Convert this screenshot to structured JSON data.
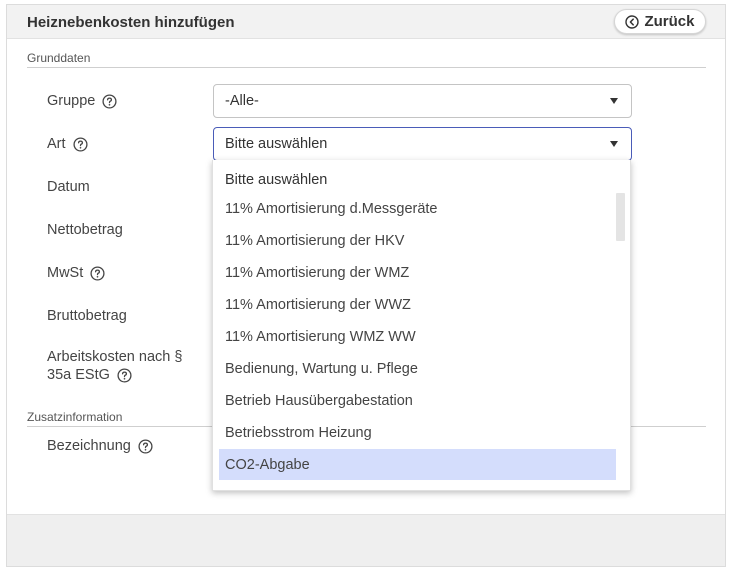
{
  "header": {
    "title": "Heiznebenkosten hinzufügen",
    "back_label": "Zurück"
  },
  "sections": {
    "grunddaten": "Grunddaten",
    "zusatz": "Zusatzinformation"
  },
  "fields": {
    "gruppe": "Gruppe",
    "art": "Art",
    "datum": "Datum",
    "netto": "Nettobetrag",
    "mwst": "MwSt",
    "brutto": "Bruttobetrag",
    "arbeit_line1": "Arbeitskosten nach §",
    "arbeit_line2": "35a EStG",
    "bezeichnung": "Bezeichnung"
  },
  "selects": {
    "gruppe_value": "-Alle-",
    "art_value": "Bitte auswählen"
  },
  "dropdown": {
    "items": [
      "Bitte auswählen",
      "11% Amortisierung d.Messgeräte",
      "11% Amortisierung der HKV",
      "11% Amortisierung der WMZ",
      "11% Amortisierung der WWZ",
      "11% Amortisierung WMZ WW",
      "Bedienung, Wartung u. Pflege",
      "Betrieb Hausübergabestation",
      "Betriebsstrom Heizung",
      "CO2-Abgabe"
    ],
    "highlighted": "CO2-Abgabe"
  },
  "colors": {
    "accent": "#4a5cb8",
    "highlight": "#d4ddfc",
    "header_bg": "#f2f2f2"
  },
  "icons": {
    "back": "chevron-left-circle-icon",
    "help": "question-circle-icon",
    "caret": "caret-down-icon"
  }
}
